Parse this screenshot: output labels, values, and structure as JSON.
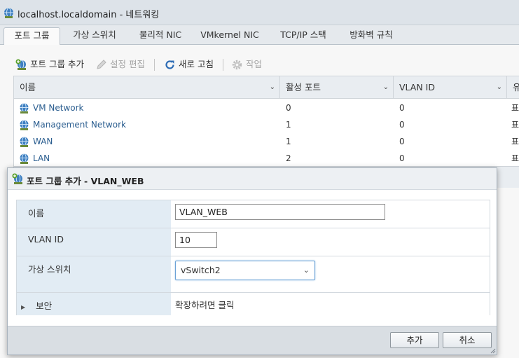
{
  "window": {
    "title": "localhost.localdomain - 네트워킹"
  },
  "tabs": [
    {
      "label": "포트 그룹",
      "active": true
    },
    {
      "label": "가상 스위치",
      "active": false
    },
    {
      "label": "물리적 NIC",
      "active": false
    },
    {
      "label": "VMkernel NIC",
      "active": false
    },
    {
      "label": "TCP/IP 스택",
      "active": false
    },
    {
      "label": "방화벽 규칙",
      "active": false
    }
  ],
  "toolbar": {
    "add_port_group": "포트 그룹 추가",
    "edit_settings": "설정 편집",
    "refresh": "새로 고침",
    "actions": "작업"
  },
  "grid": {
    "columns": [
      "이름",
      "활성 포트",
      "VLAN ID",
      "유"
    ],
    "rows": [
      {
        "name": "VM Network",
        "active_ports": "0",
        "vlan_id": "0",
        "extra": "표"
      },
      {
        "name": "Management Network",
        "active_ports": "1",
        "vlan_id": "0",
        "extra": "표"
      },
      {
        "name": "WAN",
        "active_ports": "1",
        "vlan_id": "0",
        "extra": "표"
      },
      {
        "name": "LAN",
        "active_ports": "2",
        "vlan_id": "0",
        "extra": "표"
      }
    ]
  },
  "modal": {
    "title": "포트 그룹 추가 - VLAN_WEB",
    "fields": {
      "name_label": "이름",
      "name_value": "VLAN_WEB",
      "vlan_label": "VLAN ID",
      "vlan_value": "10",
      "vswitch_label": "가상 스위치",
      "vswitch_value": "vSwitch2",
      "security_label": "보안",
      "security_hint": "확장하려면 클릭"
    },
    "buttons": {
      "add": "추가",
      "cancel": "취소"
    }
  },
  "colors": {
    "link": "#2a5d8f",
    "label_bg": "#e2ecf4",
    "select_focus": "#6aa1d6"
  }
}
